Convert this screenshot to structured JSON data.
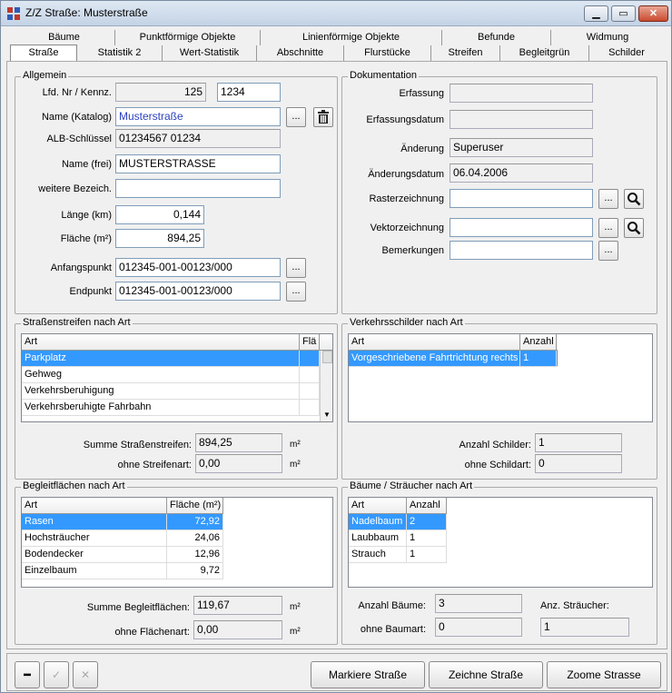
{
  "window": {
    "title": "Z/Z Straße: Musterstraße",
    "min": "▁",
    "max": "▭",
    "close": "✕"
  },
  "tabs_row1": [
    "Bäume",
    "Punktförmige Objekte",
    "Linienförmige Objekte",
    "Befunde",
    "Widmung"
  ],
  "tabs_row2": [
    "Straße",
    "Statistik 2",
    "Wert-Statistik",
    "Abschnitte",
    "Flurstücke",
    "Streifen",
    "Begleitgrün",
    "Schilder"
  ],
  "allgemein": {
    "title": "Allgemein",
    "lfd_label": "Lfd. Nr / Kennz.",
    "lfd_value": "125",
    "kennz_value": "1234",
    "name_katalog_label": "Name (Katalog)",
    "name_katalog_value": "Musterstraße",
    "alb_label": "ALB-Schlüssel",
    "alb_value": "01234567  01234",
    "name_frei_label": "Name (frei)",
    "name_frei_value": "MUSTERSTRASSE",
    "weitere_label": "weitere Bezeich.",
    "weitere_value": "",
    "laenge_label": "Länge (km)",
    "laenge_value": "0,144",
    "flaeche_label": "Fläche (m²)",
    "flaeche_value": "894,25",
    "anfang_label": "Anfangspunkt",
    "anfang_value": "012345-001-00123/000",
    "end_label": "Endpunkt",
    "end_value": "012345-001-00123/000",
    "dots": "..."
  },
  "dokumentation": {
    "title": "Dokumentation",
    "erfassung_label": "Erfassung",
    "erfassung_value": "",
    "erfassungsdatum_label": "Erfassungsdatum",
    "erfassungsdatum_value": "",
    "aenderung_label": "Änderung",
    "aenderung_value": "Superuser",
    "aenderungsdatum_label": "Änderungsdatum",
    "aenderungsdatum_value": "06.04.2006",
    "raster_label": "Rasterzeichnung",
    "raster_value": "",
    "vektor_label": "Vektorzeichnung",
    "vektor_value": "",
    "bemerkungen_label": "Bemerkungen",
    "bemerkungen_value": "",
    "dots": "..."
  },
  "strassenstreifen": {
    "title": "Straßenstreifen nach Art",
    "col_art": "Art",
    "col_flaeche": "Flä",
    "rows": [
      "Parkplatz",
      "Gehweg",
      "Verkehrsberuhigung",
      "Verkehrsberuhigte Fahrbahn"
    ],
    "summe_label": "Summe Straßenstreifen:",
    "summe_value": "894,25",
    "ohne_label": "ohne Streifenart:",
    "ohne_value": "0,00",
    "unit": "m²"
  },
  "verkehrsschilder": {
    "title": "Verkehrsschilder nach Art",
    "col_art": "Art",
    "col_anzahl": "Anzahl",
    "rows": [
      {
        "art": "Vorgeschriebene Fahrtrichtung rechts",
        "anzahl": "1"
      }
    ],
    "anzahl_label": "Anzahl Schilder:",
    "anzahl_value": "1",
    "ohne_label": "ohne Schildart:",
    "ohne_value": "0"
  },
  "begleitflaechen": {
    "title": "Begleitflächen nach Art",
    "col_art": "Art",
    "col_flaeche": "Fläche (m²)",
    "rows": [
      {
        "art": "Rasen",
        "flaeche": "72,92"
      },
      {
        "art": "Hochsträucher",
        "flaeche": "24,06"
      },
      {
        "art": "Bodendecker",
        "flaeche": "12,96"
      },
      {
        "art": "Einzelbaum",
        "flaeche": "9,72"
      }
    ],
    "summe_label": "Summe Begleitflächen:",
    "summe_value": "119,67",
    "ohne_label": "ohne Flächenart:",
    "ohne_value": "0,00",
    "unit": "m²"
  },
  "baeume": {
    "title": "Bäume / Sträucher nach Art",
    "col_art": "Art",
    "col_anzahl": "Anzahl",
    "rows": [
      {
        "art": "Nadelbaum",
        "anzahl": "2"
      },
      {
        "art": "Laubbaum",
        "anzahl": "1"
      },
      {
        "art": "Strauch",
        "anzahl": "1"
      }
    ],
    "anzahl_baeume_label": "Anzahl Bäume:",
    "anzahl_baeume_value": "3",
    "anz_straeucher_label": "Anz. Sträucher:",
    "ohne_label": "ohne Baumart:",
    "ohne_value": "0",
    "straeucher_value": "1"
  },
  "bottom": {
    "minus": "━",
    "check": "✓",
    "cross": "✕",
    "markiere": "Markiere Straße",
    "zeichne": "Zeichne Straße",
    "zoome": "Zoome Strasse"
  },
  "colors": {
    "selection": "#3399ff",
    "link_text": "#2b3fbf"
  }
}
